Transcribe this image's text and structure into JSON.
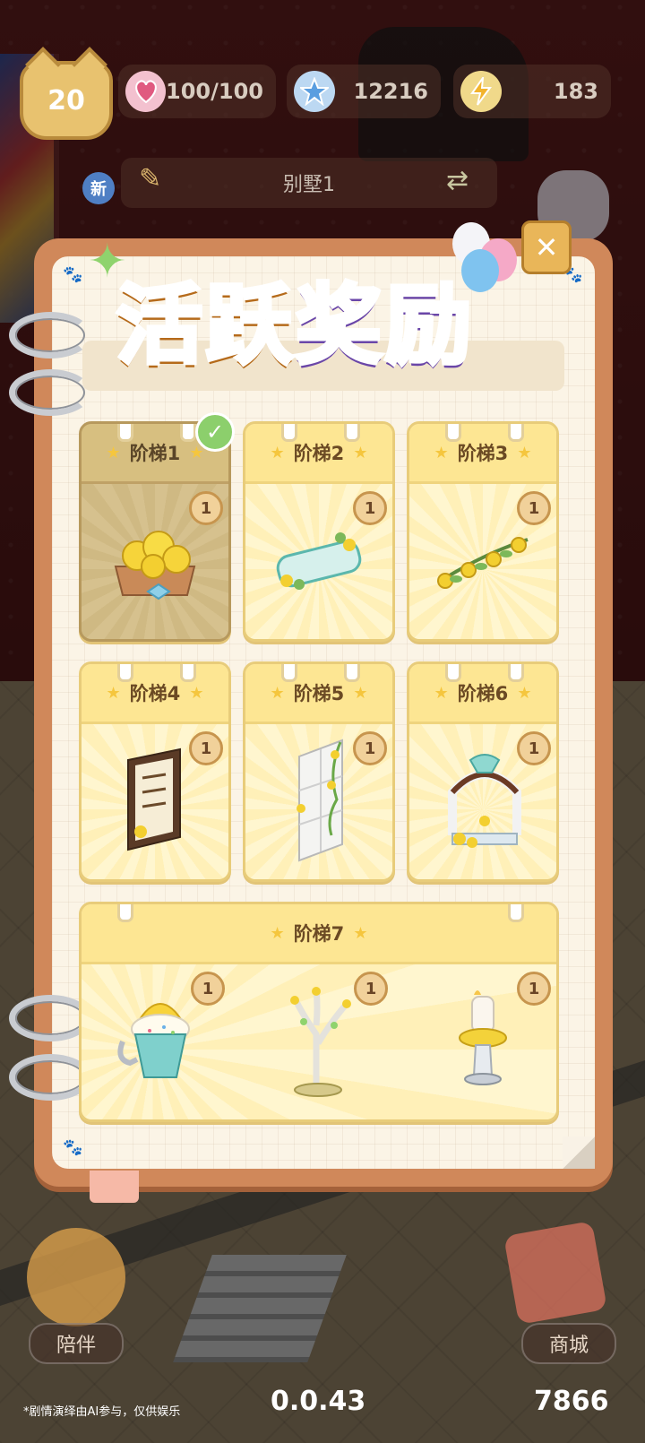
{
  "hud": {
    "level": "20",
    "stamina": "100/100",
    "stars": "12216",
    "energy": "183"
  },
  "room": {
    "new_badge": "新",
    "name": "别墅1"
  },
  "panel": {
    "title_part1": "活跃",
    "title_part2": "奖励",
    "close_label": "✕"
  },
  "tiers": [
    {
      "label": "阶梯1",
      "claimed": true,
      "rewards": [
        {
          "item": "lemon-tart",
          "count": "1"
        }
      ]
    },
    {
      "label": "阶梯2",
      "claimed": false,
      "rewards": [
        {
          "item": "lemon-sign",
          "count": "1"
        }
      ]
    },
    {
      "label": "阶梯3",
      "claimed": false,
      "rewards": [
        {
          "item": "lemon-garland",
          "count": "1"
        }
      ]
    },
    {
      "label": "阶梯4",
      "claimed": false,
      "rewards": [
        {
          "item": "menu-board",
          "count": "1"
        }
      ]
    },
    {
      "label": "阶梯5",
      "claimed": false,
      "rewards": [
        {
          "item": "vine-door",
          "count": "1"
        }
      ]
    },
    {
      "label": "阶梯6",
      "claimed": false,
      "rewards": [
        {
          "item": "lemon-arch",
          "count": "1"
        }
      ]
    },
    {
      "label": "阶梯7",
      "claimed": false,
      "rewards": [
        {
          "item": "ice-cream-cup",
          "count": "1"
        },
        {
          "item": "lemon-tree",
          "count": "1"
        },
        {
          "item": "candle-lamp",
          "count": "1"
        }
      ]
    }
  ],
  "bottom": {
    "companion_label": "陪伴",
    "shop_label": "商城",
    "disclaimer": "*剧情演绎由AI参与，仅供娱乐",
    "version": "0.0.43",
    "score": "7866"
  },
  "colors": {
    "accent_orange": "#f3a33b",
    "accent_purple": "#a677e0",
    "card_yellow": "#fde693",
    "claimed_check": "#8ccf6c"
  }
}
